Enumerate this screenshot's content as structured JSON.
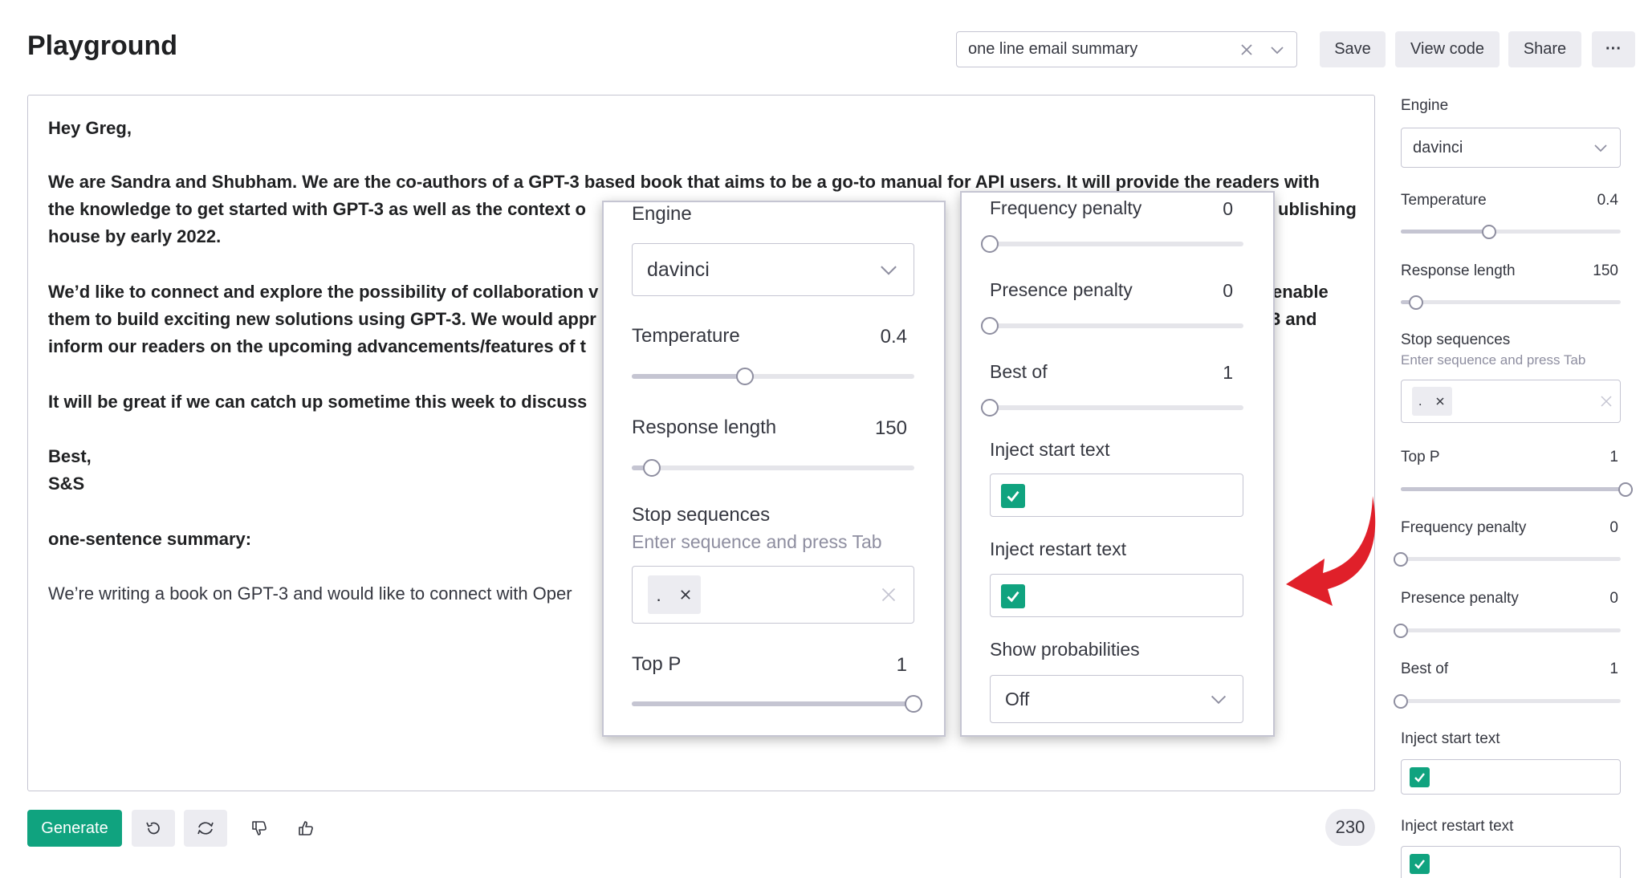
{
  "header": {
    "title": "Playground",
    "preset_value": "one line email summary",
    "save_label": "Save",
    "view_code_label": "View code",
    "share_label": "Share",
    "more_label": "···"
  },
  "editor": {
    "lines": [
      "Hey Greg,",
      "We are Sandra and Shubham. We are the co-authors of a GPT-3 based book that aims to be a go-to manual for API users. It will provide the readers with",
      " the knowledge to get started with GPT-3 as well as the context o",
      "ublishing",
      " house by early 2022.",
      "We’d like to connect and explore the possibility of collaboration v",
      "enable",
      "them to build exciting new solutions using GPT-3. We would appr",
      "3 and",
      "inform our readers on the upcoming advancements/features of t",
      "It will be great if we can catch up sometime this week to discuss",
      "Best,",
      "S&S",
      "one-sentence summary:",
      "We’re writing a book on GPT-3 and would like to connect with Oper"
    ]
  },
  "bottom": {
    "generate_label": "Generate",
    "token_count": "230"
  },
  "sidebar": {
    "engine_label": "Engine",
    "engine_value": "davinci",
    "temperature_label": "Temperature",
    "temperature_value": "0.4",
    "temperature_level": 0.4,
    "response_length_label": "Response length",
    "response_length_value": "150",
    "stop_sequences_label": "Stop sequences",
    "stop_sequences_help": "Enter sequence and press Tab",
    "stop_chip": ".",
    "top_p_label": "Top P",
    "top_p_value": "1",
    "top_p_level": 1,
    "frequency_penalty_label": "Frequency penalty",
    "frequency_penalty_value": "0",
    "presence_penalty_label": "Presence penalty",
    "presence_penalty_value": "0",
    "best_of_label": "Best of",
    "best_of_value": "1",
    "inject_start_label": "Inject start text",
    "inject_start_checked": true,
    "inject_restart_label": "Inject restart text",
    "inject_restart_checked": true
  },
  "zoom_left": {
    "engine_label": "Engine",
    "engine_value": "davinci",
    "temperature_label": "Temperature",
    "temperature_value": "0.4",
    "response_length_label": "Response length",
    "response_length_value": "150",
    "stop_sequences_label": "Stop sequences",
    "stop_sequences_help": "Enter sequence and press Tab",
    "stop_chip": ".",
    "top_p_label": "Top P",
    "top_p_value": "1"
  },
  "zoom_right": {
    "frequency_penalty_label": "Frequency penalty",
    "frequency_penalty_value": "0",
    "presence_penalty_label": "Presence penalty",
    "presence_penalty_value": "0",
    "best_of_label": "Best of",
    "best_of_value": "1",
    "inject_start_label": "Inject start text",
    "inject_restart_label": "Inject restart text",
    "show_probabilities_label": "Show probabilities",
    "show_probabilities_value": "Off"
  },
  "colors": {
    "accent": "#10a37f",
    "arrow": "#e0202a",
    "border": "#c5c5d2"
  }
}
